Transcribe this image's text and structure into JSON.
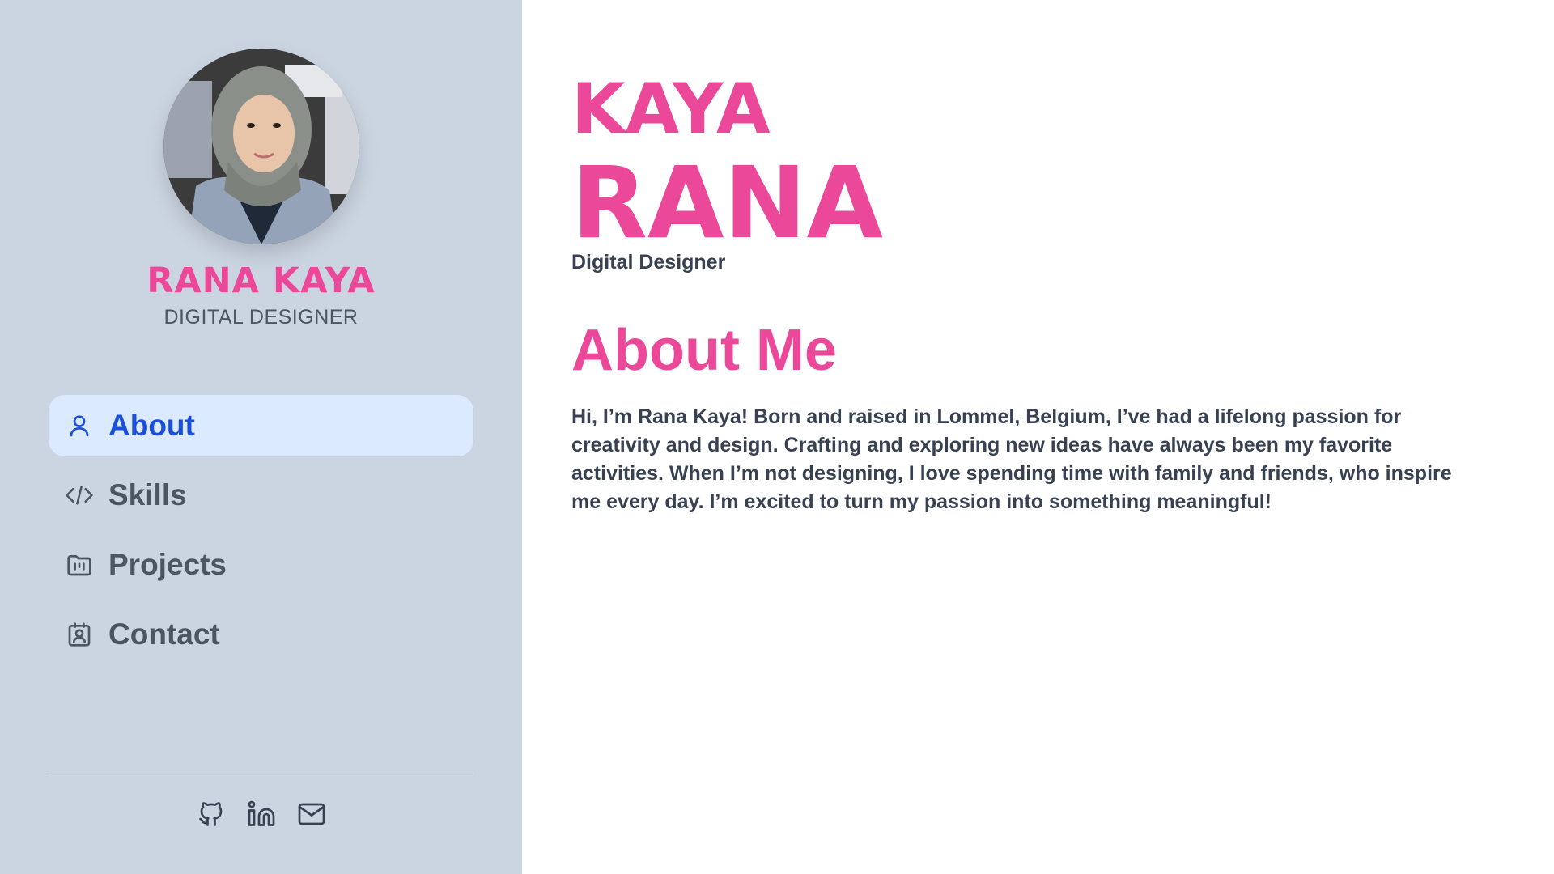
{
  "sidebar": {
    "name": "RANA KAYA",
    "role": "DIGITAL DESIGNER",
    "nav": [
      {
        "label": "About",
        "icon": "user-icon",
        "active": true
      },
      {
        "label": "Skills",
        "icon": "code-icon",
        "active": false
      },
      {
        "label": "Projects",
        "icon": "folder-icon",
        "active": false
      },
      {
        "label": "Contact",
        "icon": "contact-icon",
        "active": false
      }
    ],
    "socials": [
      {
        "icon": "github-icon"
      },
      {
        "icon": "linkedin-icon"
      },
      {
        "icon": "mail-icon"
      }
    ]
  },
  "main": {
    "last_name": "KAYA",
    "first_name": "RANA",
    "role": "Digital Designer",
    "section_title": "About Me",
    "about_text": "Hi, I’m Rana Kaya! Born and raised in Lommel, Belgium, I’ve had a lifelong passion for creativity and design. Crafting and exploring new ideas have always been my favorite activities. When I’m not designing, I love spending time with family and friends, who inspire me every day. I’m excited to turn my passion into something meaningful!"
  },
  "colors": {
    "accent": "#ec4899",
    "sidebar_bg": "#cbd5e1",
    "active_bg": "#dbeafe",
    "active_text": "#1d4ed8",
    "text": "#374151"
  }
}
